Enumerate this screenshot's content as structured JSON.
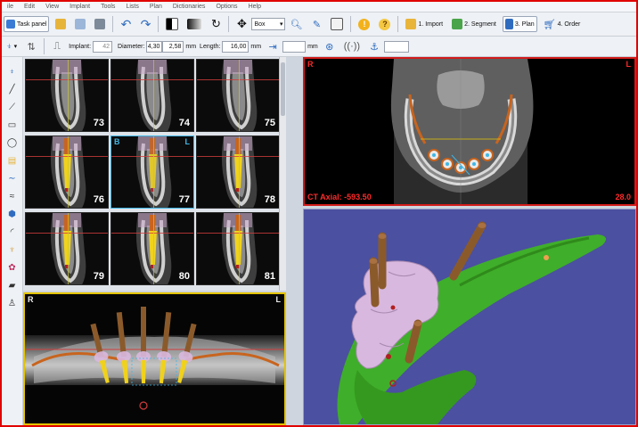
{
  "menu": [
    "ile",
    "Edit",
    "View",
    "Implant",
    "Tools",
    "Lists",
    "Plan",
    "Dictionaries",
    "Options",
    "Help"
  ],
  "toolbar": {
    "task_panel": "Task panel",
    "view_mode": "Box",
    "steps": [
      "1. Import",
      "2. Segment",
      "3. Plan",
      "4. Order"
    ]
  },
  "implant_bar": {
    "implant_label": "Implant:",
    "implant_value": "42",
    "diameter_label": "Diameter:",
    "diameter_value": "4,30",
    "diameter_value2": "2,58",
    "diameter_unit": "mm",
    "length_label": "Length:",
    "length_value": "16,00",
    "length_unit": "mm",
    "offset_unit": "mm"
  },
  "slices": {
    "numbers": [
      "73",
      "74",
      "75",
      "76",
      "77",
      "78",
      "79",
      "80",
      "81"
    ],
    "selected_corner_left": "B",
    "selected_corner_right": "L"
  },
  "axial_view": {
    "left_marker": "R",
    "right_marker": "L",
    "position_label": "CT Axial: -593.50",
    "right_value": "28.0"
  },
  "panoramic_view": {
    "left_marker": "R",
    "right_marker": "L"
  },
  "colors": {
    "selection_frame": "#e00000",
    "slice_highlight": "#3fb7e6",
    "implant_yellow": "#f0d21c",
    "implant_post": "#8b5a2b",
    "bone_green": "#3fae2a",
    "viewport_3d_bg": "#4b50a0"
  },
  "icons": [
    "task-panel-icon",
    "open-folder-icon",
    "save-icon",
    "print-icon",
    "undo-icon",
    "redo-icon",
    "contrast-icon",
    "rotate-icon",
    "move-icon",
    "zoom-icon",
    "pen-icon",
    "warning-icon",
    "help-icon",
    "import-icon",
    "segment-icon",
    "plan-icon",
    "order-cart-icon"
  ]
}
